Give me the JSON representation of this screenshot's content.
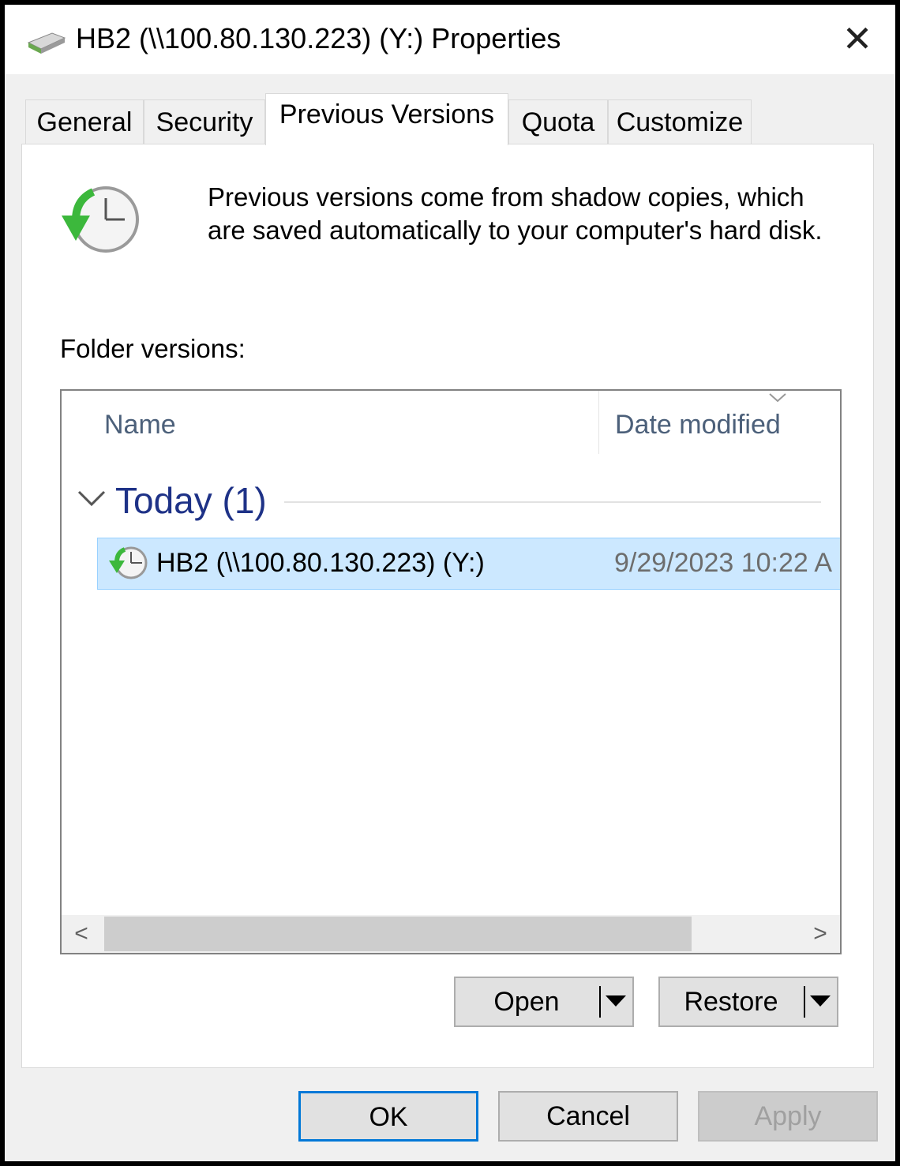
{
  "window": {
    "title": "HB2 (\\\\100.80.130.223) (Y:) Properties",
    "close_label": "✕"
  },
  "tabs": [
    {
      "label": "General",
      "active": false
    },
    {
      "label": "Security",
      "active": false
    },
    {
      "label": "Previous Versions",
      "active": true
    },
    {
      "label": "Quota",
      "active": false
    },
    {
      "label": "Customize",
      "active": false
    }
  ],
  "panel": {
    "info_line1": "Previous versions come from shadow copies, which",
    "info_line2": "are saved automatically to your computer's hard disk.",
    "folder_versions_label": "Folder versions:"
  },
  "list": {
    "columns": [
      "Name",
      "Date modified"
    ],
    "group": {
      "label": "Today (1)",
      "expanded": true
    },
    "rows": [
      {
        "name": "HB2 (\\\\100.80.130.223) (Y:)",
        "date": "9/29/2023 10:22 A",
        "selected": true
      }
    ],
    "scroll_left": "<",
    "scroll_right": ">"
  },
  "actions": {
    "open": "Open",
    "restore": "Restore"
  },
  "footer": {
    "ok": "OK",
    "cancel": "Cancel",
    "apply": "Apply",
    "apply_enabled": false
  },
  "colors": {
    "accent": "#0078d7",
    "selection": "#cce8ff",
    "group_header": "#1e3287"
  }
}
